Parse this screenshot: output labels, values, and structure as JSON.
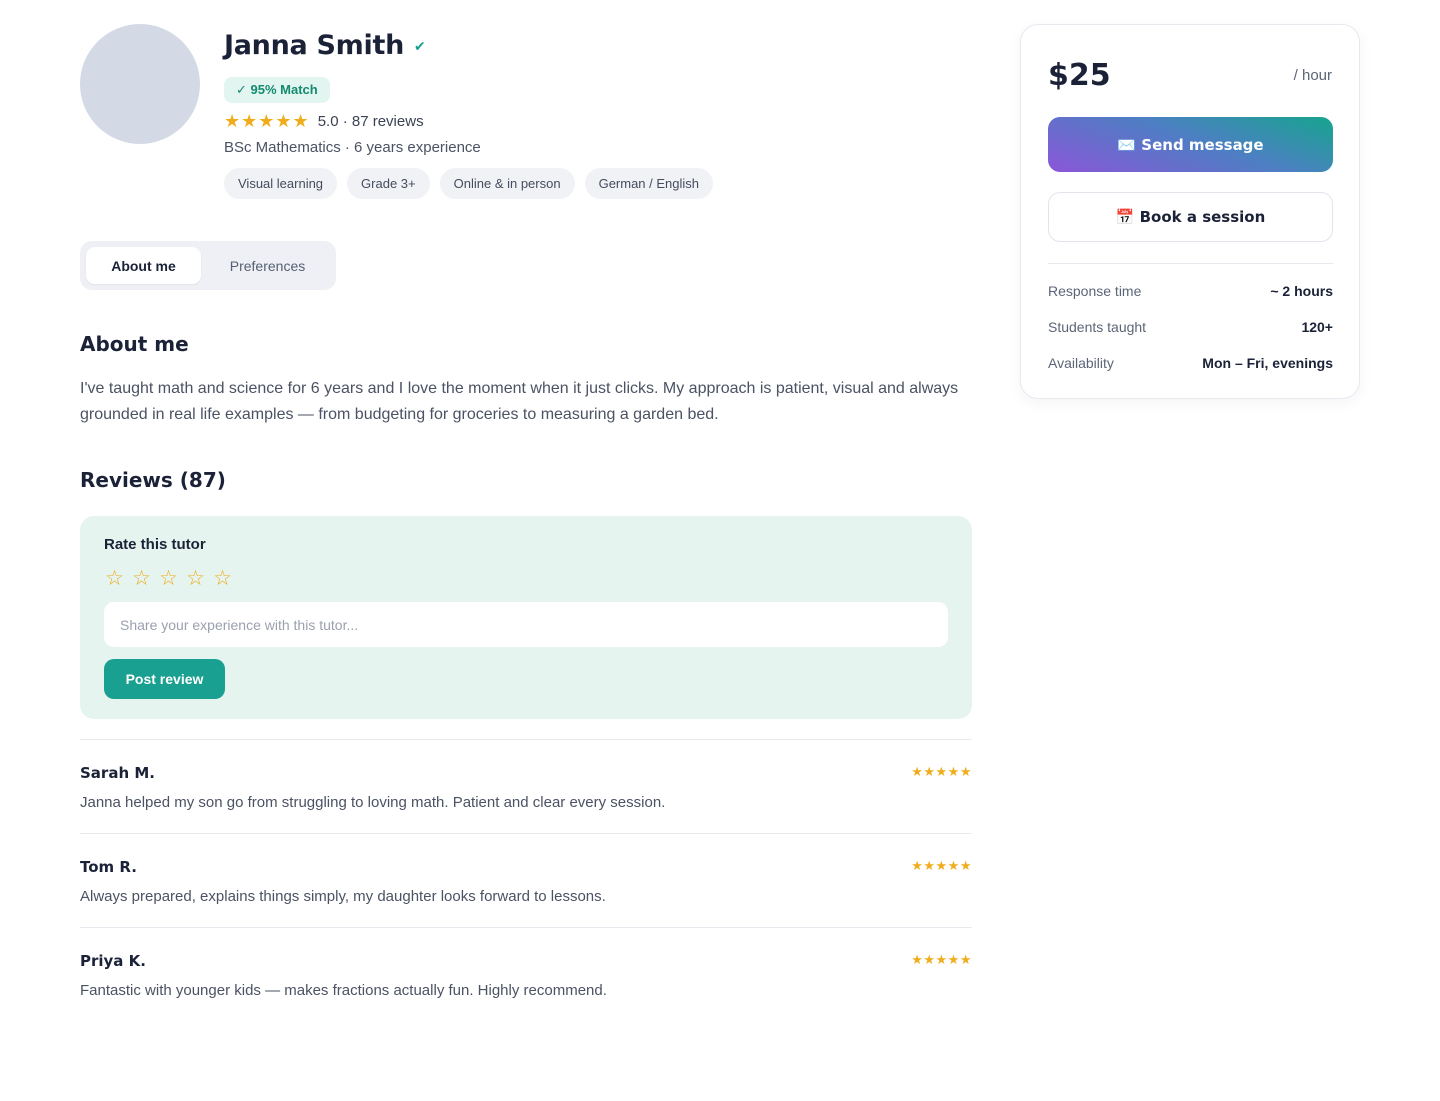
{
  "profile": {
    "name": "Janna Smith",
    "verified_icon": "✔",
    "match": "✓ 95% Match",
    "stars": "★★★★★",
    "rating_text": "5.0 · 87 reviews",
    "degree": "BSc Mathematics · 6 years experience",
    "tags": [
      "Visual learning",
      "Grade 3+",
      "Online & in person",
      "German / English"
    ]
  },
  "tabs": [
    "About me",
    "Preferences"
  ],
  "about": {
    "heading": "About me",
    "text": "I've taught math and science for 6 years and I love the moment when it just clicks. My approach is patient, visual and always grounded in real life examples — from budgeting for groceries to measuring a garden bed."
  },
  "reviews_section": {
    "heading": "Reviews (87)",
    "rate_title": "Rate this tutor",
    "rate_star": "☆",
    "input_placeholder": "Share your experience with this tutor...",
    "post_label": "Post review",
    "items": [
      {
        "name": "Sarah M.",
        "stars": "★★★★★",
        "text": "Janna helped my son go from struggling to loving math. Patient and clear every session."
      },
      {
        "name": "Tom R.",
        "stars": "★★★★★",
        "text": "Always prepared, explains things simply, my daughter looks forward to lessons."
      },
      {
        "name": "Priya K.",
        "stars": "★★★★★",
        "text": "Fantastic with younger kids — makes fractions actually fun. Highly recommend."
      }
    ]
  },
  "card": {
    "price": "$25",
    "per": "/ hour",
    "send_label": "✉️ Send message",
    "book_label": "📅 Book a session",
    "stats": [
      {
        "label": "Response time",
        "value": "~ 2 hours"
      },
      {
        "label": "Students taught",
        "value": "120+"
      },
      {
        "label": "Availability",
        "value": "Mon – Fri, evenings"
      }
    ]
  },
  "colors": {
    "accent": "#1aa090",
    "star": "#f0ad1b",
    "rate_box": "#e5f4ef",
    "text_dark": "#1b2238"
  }
}
